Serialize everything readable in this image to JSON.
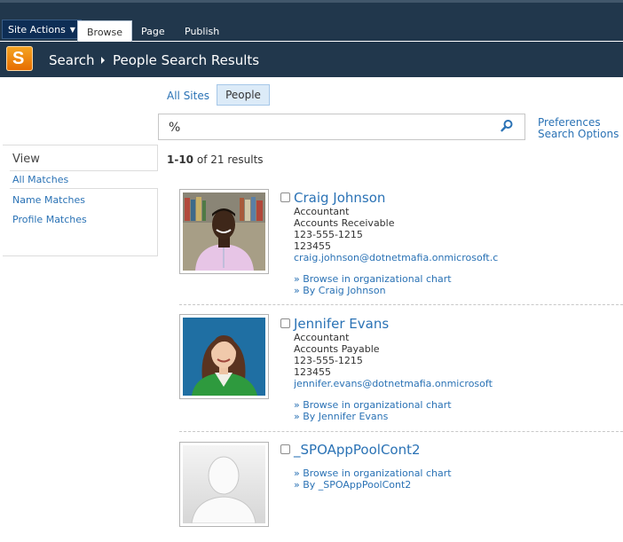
{
  "ribbon": {
    "site_actions": "Site Actions",
    "tabs": [
      "Browse",
      "Page",
      "Publish"
    ]
  },
  "title": {
    "logo_letter": "S",
    "breadcrumb_root": "Search",
    "breadcrumb_page": "People Search Results"
  },
  "scopes": {
    "all_sites": "All Sites",
    "people": "People"
  },
  "search": {
    "query": "%"
  },
  "links": {
    "preferences": "Preferences",
    "search_options": "Search Options"
  },
  "left_nav": {
    "heading": "View",
    "items": [
      "All Matches",
      "Name Matches",
      "Profile Matches"
    ]
  },
  "results_count": {
    "range": "1-10",
    "rest": "of 21 results"
  },
  "people": [
    {
      "name": "Craig Johnson",
      "title": "Accountant",
      "department": "Accounts Receivable",
      "phone": "123-555-1215",
      "office": "123455",
      "email": "craig.johnson@dotnetmafia.onmicrosoft.c",
      "org_chart": "» Browse in organizational chart",
      "by": "» By Craig Johnson"
    },
    {
      "name": "Jennifer Evans",
      "title": "Accountant",
      "department": "Accounts Payable",
      "phone": "123-555-1215",
      "office": "123455",
      "email": "jennifer.evans@dotnetmafia.onmicrosoft",
      "org_chart": "» Browse in organizational chart",
      "by": "» By Jennifer Evans"
    },
    {
      "name": "_SPOAppPoolCont2",
      "org_chart": "» Browse in organizational chart",
      "by": "» By _SPOAppPoolCont2"
    }
  ],
  "colors": {
    "ribbon_bg": "#21374c",
    "link": "#2a72b5",
    "scope_active_bg": "#dcebf8"
  }
}
